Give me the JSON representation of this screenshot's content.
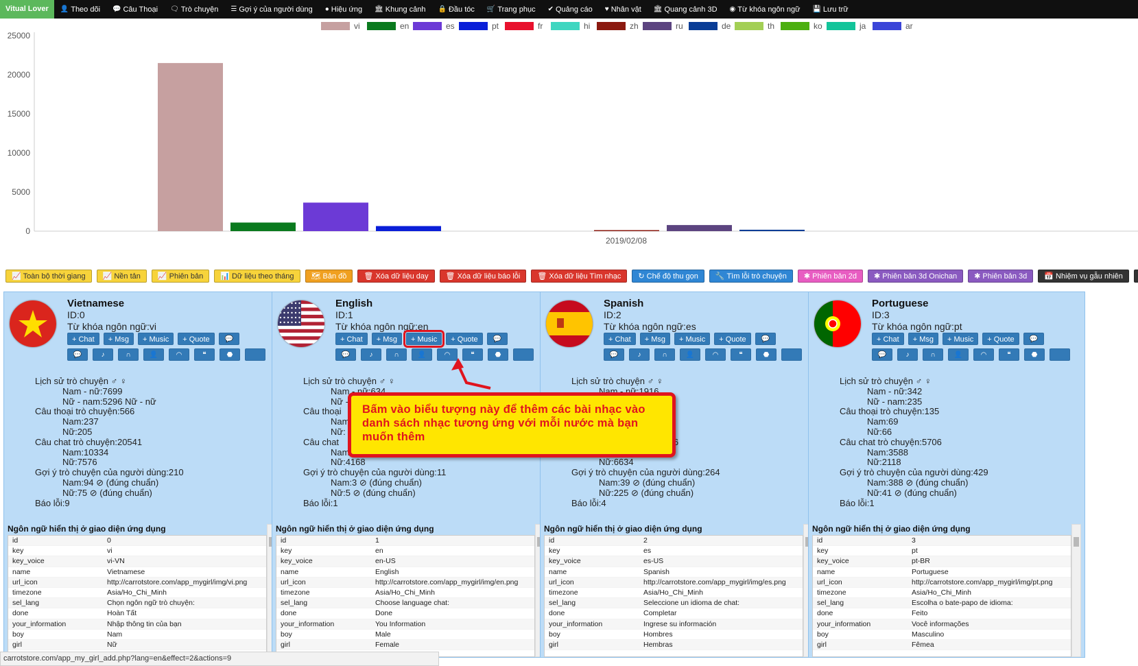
{
  "nav": {
    "brand": "Vitual Lover",
    "items": [
      {
        "label": "Theo dõi",
        "icon": "user-icon"
      },
      {
        "label": "Câu Thoại",
        "icon": "comment-icon"
      },
      {
        "label": "Trò chuyện",
        "icon": "comments-icon"
      },
      {
        "label": "Gợi ý của người dùng",
        "icon": "list-icon"
      },
      {
        "label": "Hiệu ứng",
        "icon": "circle-icon"
      },
      {
        "label": "Khung cảnh",
        "icon": "bank-icon"
      },
      {
        "label": "Đầu tóc",
        "icon": "lock-icon"
      },
      {
        "label": "Trang phục",
        "icon": "cart-icon"
      },
      {
        "label": "Quảng cáo",
        "icon": "check-circle-icon"
      },
      {
        "label": "Nhân vật",
        "icon": "heart-icon"
      },
      {
        "label": "Quang cảnh 3D",
        "icon": "bank-icon"
      },
      {
        "label": "Từ khóa ngôn ngữ",
        "icon": "record-icon"
      },
      {
        "label": "Lưu trữ",
        "icon": "save-icon"
      }
    ]
  },
  "chart_data": {
    "type": "bar",
    "categories": [
      "2019/02/08"
    ],
    "series": [
      {
        "name": "vi",
        "color": "#c6a0a0",
        "values": [
          21500
        ]
      },
      {
        "name": "en",
        "color": "#0a7a1e",
        "values": [
          1100
        ]
      },
      {
        "name": "es",
        "color": "#6c3ad6",
        "values": [
          3650
        ]
      },
      {
        "name": "pt",
        "color": "#0a1fd8",
        "values": [
          650
        ]
      },
      {
        "name": "fr",
        "color": "#e8112d",
        "values": [
          0
        ]
      },
      {
        "name": "hi",
        "color": "#3fd6c0",
        "values": [
          0
        ]
      },
      {
        "name": "zh",
        "color": "#8b1a10",
        "values": [
          130
        ]
      },
      {
        "name": "ru",
        "color": "#5c4480",
        "values": [
          780
        ]
      },
      {
        "name": "de",
        "color": "#0a3d96",
        "values": [
          180
        ]
      },
      {
        "name": "th",
        "color": "#a3cf55",
        "values": [
          0
        ]
      },
      {
        "name": "ko",
        "color": "#4caf10",
        "values": [
          0
        ]
      },
      {
        "name": "ja",
        "color": "#13c49a",
        "values": [
          0
        ]
      },
      {
        "name": "ar",
        "color": "#3b45d8",
        "values": [
          0
        ]
      }
    ],
    "yticks": [
      "25000",
      "20000",
      "15000",
      "10000",
      "5000",
      "0"
    ],
    "ylim": [
      0,
      25000
    ],
    "grid": false,
    "legend": "top-center"
  },
  "toolbar": [
    {
      "label": "Toàn bộ thời giang",
      "icon": "chart-icon",
      "color": "#f7d33b",
      "text": "#333"
    },
    {
      "label": "Nền tản",
      "icon": "chart-icon",
      "color": "#f7d33b",
      "text": "#333"
    },
    {
      "label": "Phiên bản",
      "icon": "chart-icon",
      "color": "#f7d33b",
      "text": "#333"
    },
    {
      "label": "Dữ liệu theo tháng",
      "icon": "bar-chart-icon",
      "color": "#f7d33b",
      "text": "#333"
    },
    {
      "label": "Bản đồ",
      "icon": "map-icon",
      "color": "#f0a020",
      "text": "#fff"
    },
    {
      "label": "Xóa dữ liệu day",
      "icon": "trash-icon",
      "color": "#d9362c",
      "text": "#fff"
    },
    {
      "label": "Xóa dữ liệu báo lỗi",
      "icon": "trash-icon",
      "color": "#d9362c",
      "text": "#fff"
    },
    {
      "label": "Xóa dữ liệu Tìm nhạc",
      "icon": "trash-icon",
      "color": "#d9362c",
      "text": "#fff"
    },
    {
      "label": "Chế độ thu gọn",
      "icon": "refresh-icon",
      "color": "#2f86d4",
      "text": "#fff"
    },
    {
      "label": "Tìm lỗi trò chuyện",
      "icon": "wrench-icon",
      "color": "#2f86d4",
      "text": "#fff"
    },
    {
      "label": "Phiên bản 2d",
      "icon": "star-icon",
      "color": "#e85dc2",
      "text": "#fff"
    },
    {
      "label": "Phiên bản 3d Onichan",
      "icon": "star-icon",
      "color": "#8a5ac0",
      "text": "#fff"
    },
    {
      "label": "Phiên bản 3d",
      "icon": "star-icon",
      "color": "#8a5ac0",
      "text": "#fff"
    },
    {
      "label": "Nhiệm vụ gẫu nhiên",
      "icon": "calendar-icon",
      "color": "#333",
      "text": "#fff"
    },
    {
      "label": "G",
      "icon": "calendar-icon",
      "color": "#333",
      "text": "#fff"
    }
  ],
  "cards": [
    {
      "name": "Vietnamese",
      "id": "ID:0",
      "key": "Từ khóa ngôn ngữ:vi",
      "flag": "vi",
      "stats": [
        "Lịch sử trò chuyện ♂ ♀",
        "Nam - nữ:7699",
        "Nữ - nam:5296      Nữ - nữ",
        "Câu thoại trò chuyện:566",
        "Nam:237",
        "Nữ:205",
        "Câu chat trò chuyện:20541",
        "Nam:10334",
        "Nữ:7576",
        "Gợi ý trò chuyện của người dùng:210",
        "Nam:94 ⊘ (đúng chuẩn)",
        "Nữ:75 ⊘ (đúng chuẩn)",
        "Báo lỗi:9"
      ],
      "table": [
        [
          "id",
          "0"
        ],
        [
          "key",
          "vi"
        ],
        [
          "key_voice",
          "vi-VN"
        ],
        [
          "name",
          "Vietnamese"
        ],
        [
          "url_icon",
          "http://carrotstore.com/app_mygirl/img/vi.png"
        ],
        [
          "timezone",
          "Asia/Ho_Chi_Minh"
        ],
        [
          "sel_lang",
          "Chọn ngôn ngữ trò chuyện:"
        ],
        [
          "done",
          "Hoàn Tất"
        ],
        [
          "your_information",
          "Nhập thông tin của bạn"
        ],
        [
          "boy",
          "Nam"
        ],
        [
          "girl",
          "Nữ"
        ]
      ]
    },
    {
      "name": "English",
      "id": "ID:1",
      "key": "Từ khóa ngôn ngữ:en",
      "flag": "en",
      "stats": [
        "Lịch sử trò chuyện ♂ ♀",
        "Nam - nữ:634",
        "Nữ - nam:",
        "Câu thoại",
        "Nam:",
        "Nữ:",
        "Câu chat",
        "Nam:",
        "Nữ:4168",
        "Gợi ý trò chuyện của người dùng:11",
        "Nam:3 ⊘ (đúng chuẩn)",
        "Nữ:5 ⊘ (đúng chuẩn)",
        "Báo lỗi:1"
      ],
      "table": [
        [
          "id",
          "1"
        ],
        [
          "key",
          "en"
        ],
        [
          "key_voice",
          "en-US"
        ],
        [
          "name",
          "English"
        ],
        [
          "url_icon",
          "http://carrotstore.com/app_mygirl/img/en.png"
        ],
        [
          "timezone",
          "Asia/Ho_Chi_Minh"
        ],
        [
          "sel_lang",
          "Choose language chat:"
        ],
        [
          "done",
          "Done"
        ],
        [
          "your_information",
          "You Information"
        ],
        [
          "boy",
          "Male"
        ],
        [
          "girl",
          "Female"
        ]
      ]
    },
    {
      "name": "Spanish",
      "id": "ID:2",
      "key": "Từ khóa ngôn ngữ:es",
      "flag": "es",
      "stats": [
        "Lịch sử trò chuyện ♂ ♀",
        "Nam - nữ:1916",
        "Nữ - nam:73",
        "Câu thoại trò chuyện:165",
        "Nam:",
        "Nữ:",
        "Câu chat trò chuyện:15836",
        "Nam:",
        "Nữ:6634",
        "Gợi ý trò chuyện của người dùng:264",
        "Nam:39 ⊘ (đúng chuẩn)",
        "Nữ:225 ⊘ (đúng chuẩn)",
        "Báo lỗi:4"
      ],
      "table": [
        [
          "id",
          "2"
        ],
        [
          "key",
          "es"
        ],
        [
          "key_voice",
          "es-US"
        ],
        [
          "name",
          "Spanish"
        ],
        [
          "url_icon",
          "http://carrotstore.com/app_mygirl/img/es.png"
        ],
        [
          "timezone",
          "Asia/Ho_Chi_Minh"
        ],
        [
          "sel_lang",
          "Seleccione un idioma de chat:"
        ],
        [
          "done",
          "Completar"
        ],
        [
          "your_information",
          "Ingrese su información"
        ],
        [
          "boy",
          "Hombres"
        ],
        [
          "girl",
          "Hembras"
        ]
      ]
    },
    {
      "name": "Portuguese",
      "id": "ID:3",
      "key": "Từ khóa ngôn ngữ:pt",
      "flag": "pt",
      "stats": [
        "Lịch sử trò chuyện ♂ ♀",
        "Nam - nữ:342",
        "Nữ - nam:235",
        "Câu thoại trò chuyện:135",
        "Nam:69",
        "Nữ:66",
        "Câu chat trò chuyện:5706",
        "Nam:3588",
        "Nữ:2118",
        "Gợi ý trò chuyện của người dùng:429",
        "Nam:388 ⊘ (đúng chuẩn)",
        "Nữ:41 ⊘ (đúng chuẩn)",
        "Báo lỗi:1"
      ],
      "table": [
        [
          "id",
          "3"
        ],
        [
          "key",
          "pt"
        ],
        [
          "key_voice",
          "pt-BR"
        ],
        [
          "name",
          "Portuguese"
        ],
        [
          "url_icon",
          "http://carrotstore.com/app_mygirl/img/pt.png"
        ],
        [
          "timezone",
          "Asia/Ho_Chi_Minh"
        ],
        [
          "sel_lang",
          "Escolha o bate-papo de idioma:"
        ],
        [
          "done",
          "Feito"
        ],
        [
          "your_information",
          "Você informações"
        ],
        [
          "boy",
          "Masculino"
        ],
        [
          "girl",
          "Fêmea"
        ]
      ]
    }
  ],
  "card_buttons": {
    "chat": "Chat",
    "msg": "Msg",
    "music": "Music",
    "quote": "Quote"
  },
  "lang_table_title": "Ngôn ngữ hiển thị ở giao diện ứng dụng",
  "callout": "Bấm vào biểu tượng này để thêm các bài nhạc vào danh sách nhạc tương ứng với mỗi nước mà bạn muốn thêm",
  "status_url": "carrotstore.com/app_my_girl_add.php?lang=en&effect=2&actions=9"
}
